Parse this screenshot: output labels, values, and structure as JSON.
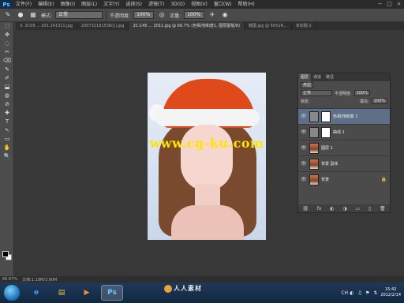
{
  "app": {
    "logo": "Ps"
  },
  "menu": [
    "文件(F)",
    "编辑(E)",
    "图像(I)",
    "图层(L)",
    "文字(Y)",
    "选择(S)",
    "滤镜(T)",
    "3D(D)",
    "视图(V)",
    "窗口(W)",
    "帮助(H)"
  ],
  "window_controls": [
    "−",
    "□",
    "×"
  ],
  "options": {
    "mode_label": "模式:",
    "mode_value": "正常",
    "opacity_label": "不透明度:",
    "opacity_value": "100%",
    "flow_label": "流量:",
    "flow_value": "100%"
  },
  "tabs": [
    "3. 2C09 ... 201.141311.jpg",
    "200732181538(1).jpg",
    "2C.C45 ... 2011.jpg @ 66.7% (色相/饱和度1, 图层蒙版/8)",
    "截图.jpg @ 50%(R...",
    "未标题-1"
  ],
  "active_tab_index": 2,
  "tools": [
    "⬚",
    "✥",
    "◌",
    "✂",
    "⌫",
    "✎",
    "✐",
    "⬓",
    "◍",
    "⊘",
    "✚",
    "T",
    "↖",
    "▭",
    "✋",
    "🔍"
  ],
  "canvas": {
    "watermark": "www.cg-ku.com"
  },
  "layers_panel": {
    "tabs": [
      "图层",
      "通道",
      "路径"
    ],
    "kind_label": "类型",
    "blend_mode": "正常",
    "opacity_label": "不透明度:",
    "opacity_value": "100%",
    "lock_label": "锁定:",
    "fill_label": "填充:",
    "fill_value": "100%",
    "layers": [
      {
        "name": "色相/饱和度 1",
        "selected": true
      },
      {
        "name": "曲线 1",
        "selected": false
      },
      {
        "name": "图层 1",
        "selected": false
      },
      {
        "name": "背景 副本",
        "selected": false
      },
      {
        "name": "背景",
        "selected": false
      }
    ],
    "footer_icons": [
      "⛓",
      "fx",
      "◐",
      "◑",
      "▭",
      "▯",
      "🗑"
    ]
  },
  "status": {
    "zoom": "66.67%",
    "doc": "文档:1.18M/3.90M"
  },
  "taskbar": {
    "apps": [
      "e",
      "▤",
      "▶",
      "Ps"
    ],
    "clock_time": "15:42",
    "clock_date": "2012/2/14",
    "tray_icons": [
      "CH",
      "◐",
      "♫",
      "⚑",
      "⇅"
    ]
  },
  "brand": {
    "text": "人人素材"
  }
}
